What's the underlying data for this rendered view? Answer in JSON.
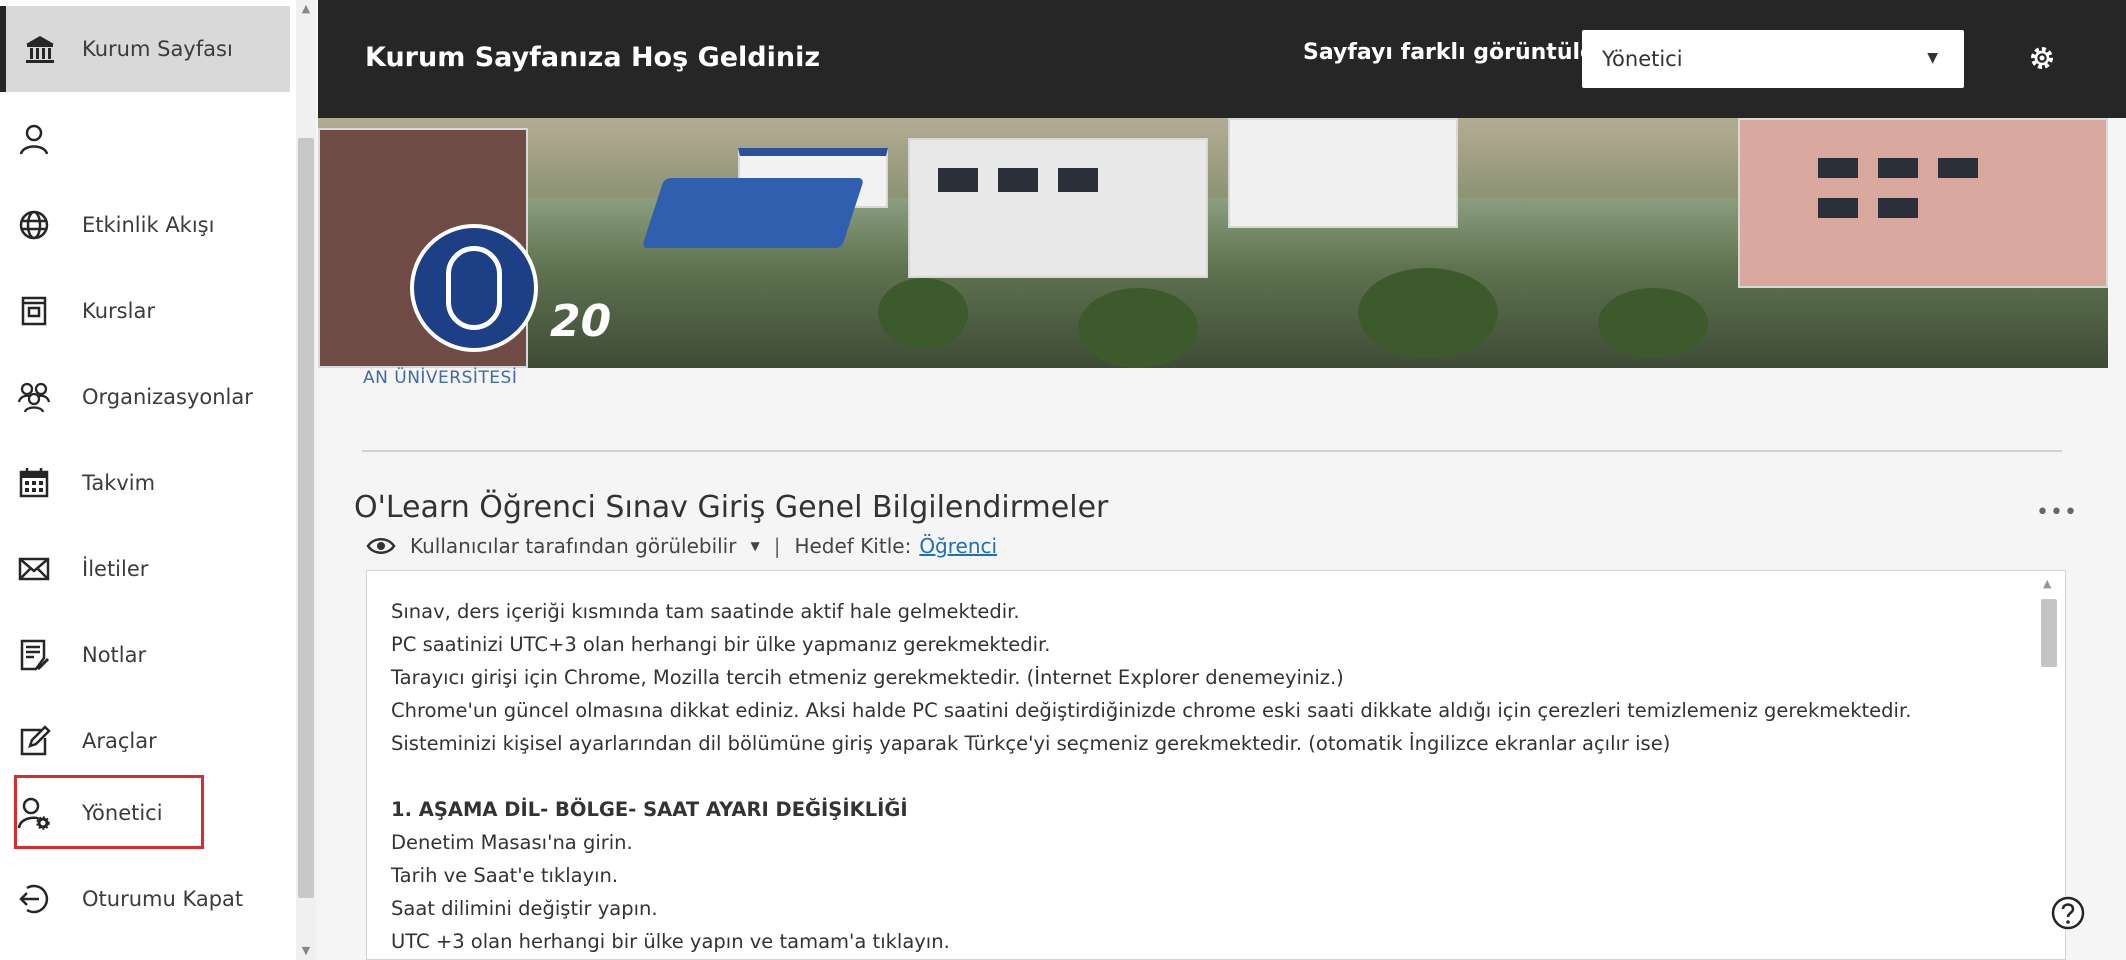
{
  "sidebar": {
    "items": [
      {
        "label": "Kurum Sayfası",
        "icon": "institution-icon"
      },
      {
        "label": "",
        "icon": "user-icon"
      },
      {
        "label": "Etkinlik Akışı",
        "icon": "globe-icon"
      },
      {
        "label": "Kurslar",
        "icon": "courses-icon"
      },
      {
        "label": "Organizasyonlar",
        "icon": "organizations-icon"
      },
      {
        "label": "Takvim",
        "icon": "calendar-icon"
      },
      {
        "label": "İletiler",
        "icon": "mail-icon"
      },
      {
        "label": "Notlar",
        "icon": "grades-icon"
      },
      {
        "label": "Araçlar",
        "icon": "tools-icon"
      },
      {
        "label": "Yönetici",
        "icon": "admin-icon"
      },
      {
        "label": "Oturumu Kapat",
        "icon": "logout-icon"
      }
    ]
  },
  "header": {
    "title": "Kurum Sayfanıza Hoş Geldiniz",
    "view_as_label": "Sayfayı farklı görüntüle",
    "role_value": "Yönetici"
  },
  "banner": {
    "logo_number": "20",
    "university_text": "AN ÜNİVERSİTESİ"
  },
  "announcement": {
    "title": "O'Learn Öğrenci Sınav Giriş Genel Bilgilendirmeler",
    "visibility": "Kullanıcılar tarafından görülebilir",
    "separator": "|",
    "audience_label": "Hedef Kitle:",
    "audience_value": "Öğrenci",
    "lines": [
      "Sınav, ders içeriği kısmında tam saatinde aktif hale gelmektedir.",
      "PC saatinizi UTC+3 olan herhangi bir ülke yapmanız gerekmektedir.",
      "Tarayıcı girişi için Chrome, Mozilla tercih etmeniz gerekmektedir. (İnternet Explorer denemeyiniz.)",
      "Chrome'un güncel olmasına dikkat ediniz. Aksi halde PC saatini değiştirdiğinizde chrome eski saati dikkate aldığı için çerezleri temizlemeniz gerekmektedir.",
      "Sisteminizi kişisel ayarlarından dil bölümüne giriş yaparak Türkçe'yi seçmeniz gerekmektedir. (otomatik İngilizce ekranlar açılır ise)"
    ],
    "step_heading": "1. AŞAMA DİL- BÖLGE- SAAT AYARI DEĞİŞİKLİĞİ",
    "step_lines": [
      "Denetim Masası'na girin.",
      "Tarih ve Saat'e tıklayın.",
      "Saat dilimini değiştir yapın.",
      "UTC +3 olan herhangi bir ülke yapın ve tamam'a tıklayın."
    ]
  },
  "colors": {
    "header_bg": "#262626",
    "active_item_bg": "#d9d9d9",
    "highlight_border": "#d32f2f",
    "link": "#1f6fb2"
  }
}
